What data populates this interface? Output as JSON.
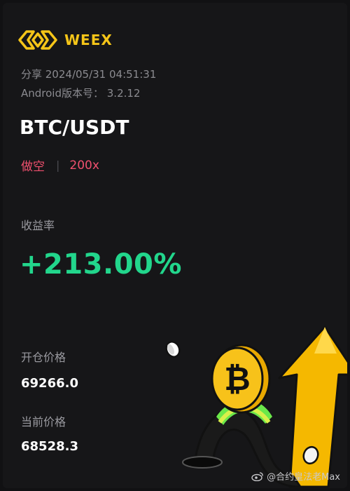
{
  "brand": {
    "name": "WEEX",
    "accent": "#f5c518"
  },
  "share": {
    "line": "分享 2024/05/31 04:51:31"
  },
  "version": {
    "line": "Android版本号： 3.2.12"
  },
  "trade": {
    "pair": "BTC/USDT",
    "side": "做空",
    "separator": "|",
    "leverage": "200x",
    "side_color": "#f0506e"
  },
  "roi": {
    "label": "收益率",
    "value": "+213.00%",
    "color": "#22d68c"
  },
  "entry": {
    "label": "开仓价格",
    "value": "69266.0"
  },
  "current": {
    "label": "当前价格",
    "value": "68528.3"
  },
  "watermark": {
    "text": "@合约皇法老Max",
    "icon": "weibo-icon"
  },
  "illustration": {
    "icon": "bitcoin-coin-icon",
    "arrow": "up-arrow-icon"
  }
}
